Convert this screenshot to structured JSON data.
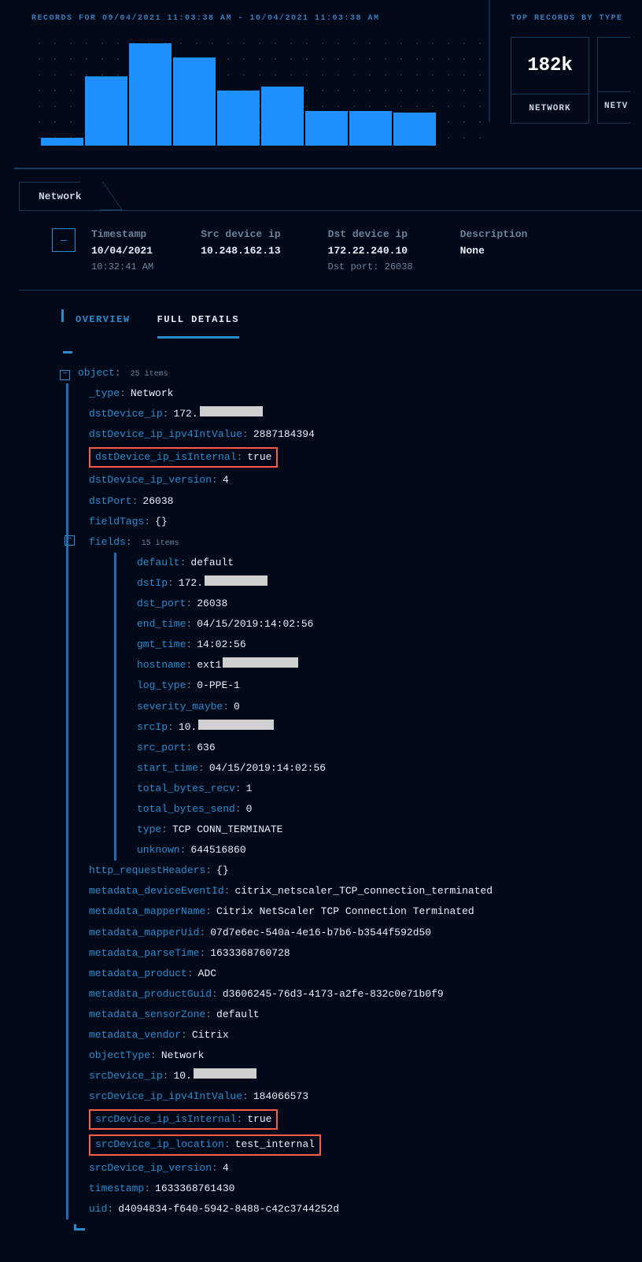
{
  "histogram": {
    "title": "RECORDS FOR 09/04/2021 11:03:38 AM - 10/04/2021 11:03:38 AM"
  },
  "top_records": {
    "title": "TOP RECORDS BY TYPE",
    "cards": [
      {
        "count": "182k",
        "label": "NETWORK"
      },
      {
        "count": "",
        "label": "NETV"
      }
    ]
  },
  "chart_data": {
    "type": "bar",
    "categories": [
      "",
      "",
      "",
      "",
      "",
      "",
      "",
      "",
      ""
    ],
    "values": [
      10,
      88,
      130,
      112,
      70,
      75,
      44,
      44,
      42
    ],
    "title": "RECORDS FOR 09/04/2021 11:03:38 AM - 10/04/2021 11:03:38 AM",
    "xlabel": "",
    "ylabel": "",
    "ylim": [
      0,
      140
    ]
  },
  "network_tab": "Network",
  "detail_header": {
    "toggle_glyph": "—",
    "timestamp": {
      "label": "Timestamp",
      "value": "10/04/2021",
      "sub": "10:32:41 AM"
    },
    "src": {
      "label": "Src device ip",
      "value": "10.248.162.13"
    },
    "dst": {
      "label": "Dst device ip",
      "value": "172.22.240.10",
      "sub": "Dst port: 26038"
    },
    "desc": {
      "label": "Description",
      "value": "None"
    }
  },
  "subtabs": {
    "overview": "OVERVIEW",
    "full": "FULL DETAILS"
  },
  "tree": {
    "root_label": "object",
    "root_count": "25 items",
    "collapse_glyph": "−",
    "items": [
      {
        "k": "_type",
        "v": "Network"
      },
      {
        "k": "dstDevice_ip",
        "v": "172.",
        "redact": 80
      },
      {
        "k": "dstDevice_ip_ipv4IntValue",
        "v": "2887184394"
      },
      {
        "k": "dstDevice_ip_isInternal",
        "v": "true",
        "hl": true
      },
      {
        "k": "dstDevice_ip_version",
        "v": "4"
      },
      {
        "k": "dstPort",
        "v": "26038"
      },
      {
        "k": "fieldTags",
        "v": "{}"
      }
    ],
    "fields_label": "fields",
    "fields_count": "15 items",
    "fields": [
      {
        "k": "default",
        "v": "default"
      },
      {
        "k": "dstIp",
        "v": "172.",
        "redact": 80
      },
      {
        "k": "dst_port",
        "v": "26038"
      },
      {
        "k": "end_time",
        "v": "04/15/2019:14:02:56"
      },
      {
        "k": "gmt_time",
        "v": "14:02:56"
      },
      {
        "k": "hostname",
        "v": "ext1",
        "redact": 96
      },
      {
        "k": "log_type",
        "v": "0-PPE-1"
      },
      {
        "k": "severity_maybe",
        "v": "0"
      },
      {
        "k": "srcIp",
        "v": "10.",
        "redact": 96
      },
      {
        "k": "src_port",
        "v": "636"
      },
      {
        "k": "start_time",
        "v": "04/15/2019:14:02:56"
      },
      {
        "k": "total_bytes_recv",
        "v": "1"
      },
      {
        "k": "total_bytes_send",
        "v": "0"
      },
      {
        "k": "type",
        "v": "TCP CONN_TERMINATE"
      },
      {
        "k": "unknown",
        "v": "644516860"
      }
    ],
    "items2": [
      {
        "k": "http_requestHeaders",
        "v": "{}"
      },
      {
        "k": "metadata_deviceEventId",
        "v": "citrix_netscaler_TCP_connection_terminated"
      },
      {
        "k": "metadata_mapperName",
        "v": "Citrix NetScaler TCP Connection Terminated"
      },
      {
        "k": "metadata_mapperUid",
        "v": "07d7e6ec-540a-4e16-b7b6-b3544f592d50"
      },
      {
        "k": "metadata_parseTime",
        "v": "1633368760728"
      },
      {
        "k": "metadata_product",
        "v": "ADC"
      },
      {
        "k": "metadata_productGuid",
        "v": "d3606245-76d3-4173-a2fe-832c0e71b0f9"
      },
      {
        "k": "metadata_sensorZone",
        "v": "default"
      },
      {
        "k": "metadata_vendor",
        "v": "Citrix"
      },
      {
        "k": "objectType",
        "v": "Network"
      },
      {
        "k": "srcDevice_ip",
        "v": "10.",
        "redact": 80
      },
      {
        "k": "srcDevice_ip_ipv4IntValue",
        "v": "184066573"
      },
      {
        "k": "srcDevice_ip_isInternal",
        "v": "true",
        "hl": true
      },
      {
        "k": "srcDevice_ip_location",
        "v": "test_internal",
        "hl": true
      },
      {
        "k": "srcDevice_ip_version",
        "v": "4"
      },
      {
        "k": "timestamp",
        "v": "1633368761430"
      },
      {
        "k": "uid",
        "v": "d4094834-f640-5942-8488-c42c3744252d"
      }
    ]
  }
}
